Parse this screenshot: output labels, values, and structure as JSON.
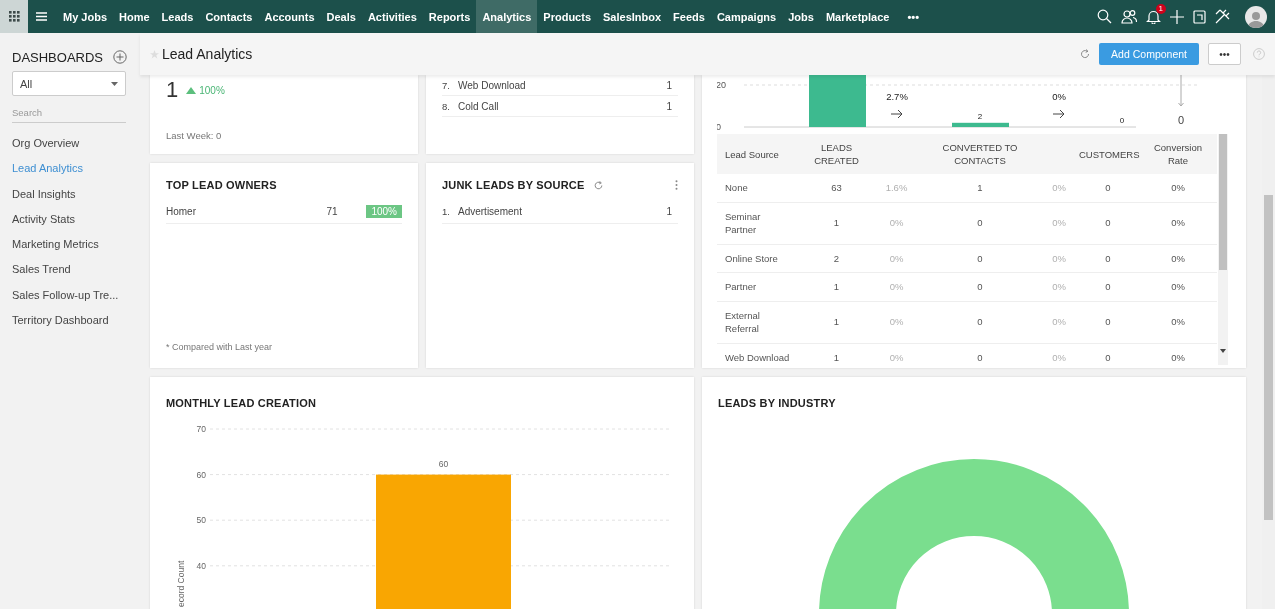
{
  "nav": {
    "items": [
      {
        "label": "My Jobs",
        "selected": false
      },
      {
        "label": "Home",
        "selected": false
      },
      {
        "label": "Leads",
        "selected": false
      },
      {
        "label": "Contacts",
        "selected": false
      },
      {
        "label": "Accounts",
        "selected": false
      },
      {
        "label": "Deals",
        "selected": false
      },
      {
        "label": "Activities",
        "selected": false
      },
      {
        "label": "Reports",
        "selected": false
      },
      {
        "label": "Analytics",
        "selected": true
      },
      {
        "label": "Products",
        "selected": false
      },
      {
        "label": "SalesInbox",
        "selected": false
      },
      {
        "label": "Feeds",
        "selected": false
      },
      {
        "label": "Campaigns",
        "selected": false
      },
      {
        "label": "Jobs",
        "selected": false
      },
      {
        "label": "Marketplace",
        "selected": false
      }
    ],
    "more": "•••",
    "notification_count": "1"
  },
  "sidebar": {
    "title": "DASHBOARDS",
    "filter": "All",
    "search": {
      "placeholder": "Search"
    },
    "items": [
      {
        "label": "Org Overview",
        "selected": false
      },
      {
        "label": "Lead Analytics",
        "selected": true
      },
      {
        "label": "Deal Insights",
        "selected": false
      },
      {
        "label": "Activity Stats",
        "selected": false
      },
      {
        "label": "Marketing Metrics",
        "selected": false
      },
      {
        "label": "Sales Trend",
        "selected": false
      },
      {
        "label": "Sales Follow-up Tre...",
        "selected": false
      },
      {
        "label": "Territory Dashboard",
        "selected": false
      }
    ]
  },
  "header": {
    "title": "Lead Analytics",
    "add_button": "Add Component",
    "more_button": "•••"
  },
  "kpi_card": {
    "value": "1",
    "change": "100%",
    "footer": "Last Week: 0"
  },
  "source_list_card": {
    "rows": [
      {
        "index": "7.",
        "label": "Web Download",
        "count": "1"
      },
      {
        "index": "8.",
        "label": "Cold Call",
        "count": "1"
      }
    ]
  },
  "funnel_card": {
    "axis_labels": [
      "20",
      "0"
    ],
    "stage_rates": [
      "2.7%",
      "0%"
    ],
    "bar_labels": [
      "2",
      "0"
    ],
    "final_count": "0",
    "table": {
      "columns": [
        "Lead Source",
        "LEADS CREATED",
        "CONVERTED TO CONTACTS",
        "CUSTOMERS",
        "Conversion Rate"
      ],
      "rows": [
        {
          "source": "None",
          "leads_created": "63",
          "leads_rate": "1.6%",
          "converted": "1",
          "converted_rate": "0%",
          "customers": "0",
          "conversion_rate": "0%"
        },
        {
          "source": "Seminar Partner",
          "leads_created": "1",
          "leads_rate": "0%",
          "converted": "0",
          "converted_rate": "0%",
          "customers": "0",
          "conversion_rate": "0%"
        },
        {
          "source": "Online Store",
          "leads_created": "2",
          "leads_rate": "0%",
          "converted": "0",
          "converted_rate": "0%",
          "customers": "0",
          "conversion_rate": "0%"
        },
        {
          "source": "Partner",
          "leads_created": "1",
          "leads_rate": "0%",
          "converted": "0",
          "converted_rate": "0%",
          "customers": "0",
          "conversion_rate": "0%"
        },
        {
          "source": "External Referral",
          "leads_created": "1",
          "leads_rate": "0%",
          "converted": "0",
          "converted_rate": "0%",
          "customers": "0",
          "conversion_rate": "0%"
        },
        {
          "source": "Web Download",
          "leads_created": "1",
          "leads_rate": "0%",
          "converted": "0",
          "converted_rate": "0%",
          "customers": "0",
          "conversion_rate": "0%"
        }
      ]
    }
  },
  "top_lead_owners": {
    "title": "TOP LEAD OWNERS",
    "rows": [
      {
        "name": "Homer",
        "count": "71",
        "share": "100%"
      }
    ],
    "footnote": "* Compared with Last year"
  },
  "junk_leads": {
    "title": "JUNK LEADS BY SOURCE",
    "rows": [
      {
        "index": "1.",
        "label": "Advertisement",
        "count": "1"
      }
    ]
  },
  "monthly_lead_creation": {
    "title": "MONTHLY LEAD CREATION",
    "chart_data": {
      "type": "bar",
      "ylabel": "ecord Count",
      "values": [
        60
      ],
      "yticks": [
        40,
        50,
        60,
        70
      ],
      "ylim": [
        0,
        70
      ],
      "grid": true,
      "data_labels": true
    }
  },
  "leads_by_industry": {
    "title": "LEADS BY INDUSTRY"
  }
}
